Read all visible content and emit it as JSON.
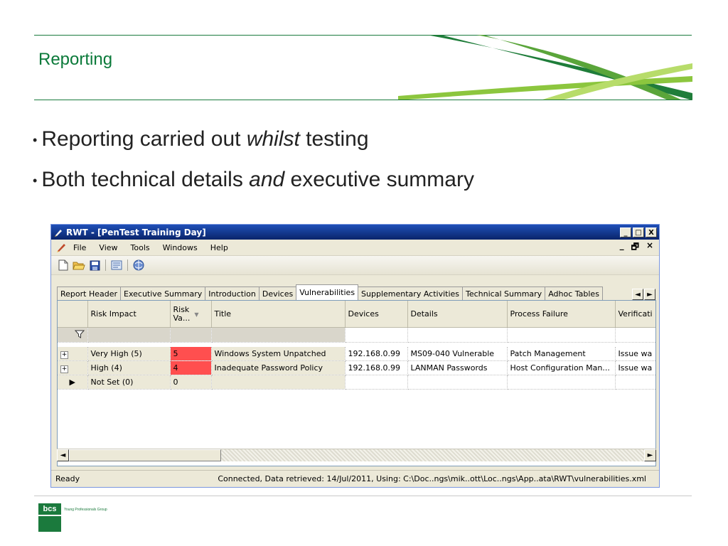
{
  "slide": {
    "title": "Reporting",
    "bullets": [
      {
        "before": "Reporting carried out ",
        "emph": "whilst",
        "after": " testing"
      },
      {
        "before": "Both technical details ",
        "emph": "and",
        "after": " executive summary"
      }
    ],
    "brand_color": "#0b7a3a"
  },
  "window": {
    "title": "RWT - [PenTest Training Day]",
    "controls": {
      "minimize": "_",
      "maximize": "□",
      "close": "X"
    },
    "mdi_controls": {
      "minimize": "_",
      "restore": "🗗",
      "close": "×"
    }
  },
  "menu": [
    "File",
    "View",
    "Tools",
    "Windows",
    "Help"
  ],
  "toolbar": [
    "new-icon",
    "open-icon",
    "save-icon",
    "report-icon",
    "globe-icon"
  ],
  "tabs": [
    {
      "label": "Report Header",
      "active": false
    },
    {
      "label": "Executive Summary",
      "active": false
    },
    {
      "label": "Introduction",
      "active": false
    },
    {
      "label": "Devices",
      "active": false
    },
    {
      "label": "Vulnerabilities",
      "active": true
    },
    {
      "label": "Supplementary Activities",
      "active": false
    },
    {
      "label": "Technical Summary",
      "active": false
    },
    {
      "label": "Adhoc Tables",
      "active": false
    }
  ],
  "tab_scroll": {
    "left": "◄",
    "right": "►"
  },
  "grid": {
    "columns": [
      "",
      "Risk Impact",
      "Risk Va...",
      "Title",
      "Devices",
      "Details",
      "Process Failure",
      "Verificati"
    ],
    "risk_col_top": "Risk",
    "risk_col_bottom": "Va...",
    "rows": [
      {
        "expander": "+",
        "risk_impact": "Very High (5)",
        "risk_value": "5",
        "title": "Windows System Unpatched",
        "devices": "192.168.0.99",
        "details": "MS09-040 Vulnerable",
        "process_failure": "Patch Management",
        "verification": "Issue wa",
        "highlight": "#ff4f4f"
      },
      {
        "expander": "+",
        "risk_impact": "High (4)",
        "risk_value": "4",
        "title": "Inadequate Password Policy",
        "devices": "192.168.0.99",
        "details": "LANMAN Passwords",
        "process_failure": "Host Configuration Man...",
        "verification": "Issue wa",
        "highlight": "#ff4f4f"
      },
      {
        "expander": "▶",
        "risk_impact": "Not Set (0)",
        "risk_value": "0",
        "title": "",
        "devices": "",
        "details": "",
        "process_failure": "",
        "verification": "",
        "highlight": ""
      }
    ]
  },
  "scroll": {
    "left": "◄",
    "right": "►"
  },
  "status": {
    "left": "Ready",
    "right": "Connected, Data retrieved: 14/Jul/2011, Using: C:\\Doc..ngs\\mik..ott\\Loc..ngs\\App..ata\\RWT\\vulnerabilities.xml"
  },
  "footer": {
    "logo_text": "bcs",
    "tagline": "Young Professionals Group",
    "logo_color": "#1b7a3d"
  }
}
